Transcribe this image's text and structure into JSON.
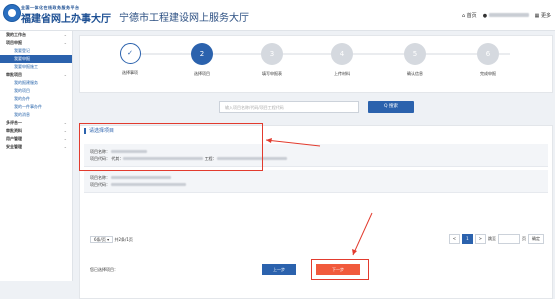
{
  "header": {
    "logo_small": "全国一体化在线政务服务平台",
    "logo_big": "福建省网上办事大厅",
    "site_title": "宁德市工程建设网上服务大厅",
    "home": "首页",
    "more": "更多"
  },
  "sidebar": {
    "items": [
      {
        "label": "我的工作台",
        "type": "group"
      },
      {
        "label": "项目申报",
        "type": "group"
      },
      {
        "label": "我要登记",
        "type": "sub"
      },
      {
        "label": "我要申报",
        "type": "sub",
        "active": true
      },
      {
        "label": "我要申报施工",
        "type": "sub"
      },
      {
        "label": "审批项目",
        "type": "group"
      },
      {
        "label": "我的报建服务",
        "type": "sub"
      },
      {
        "label": "我的项目",
        "type": "sub"
      },
      {
        "label": "我的办件",
        "type": "sub"
      },
      {
        "label": "我的一件事办件",
        "type": "sub"
      },
      {
        "label": "我的消息",
        "type": "sub"
      },
      {
        "label": "多评合一",
        "type": "group"
      },
      {
        "label": "审批资料",
        "type": "group"
      },
      {
        "label": "用户管理",
        "type": "group"
      },
      {
        "label": "安全管理",
        "type": "group"
      }
    ]
  },
  "steps": [
    {
      "label": "选择事项",
      "num": "✓",
      "state": "done"
    },
    {
      "label": "选择项目",
      "num": "2",
      "state": "current"
    },
    {
      "label": "填写申报表",
      "num": "3",
      "state": "todo"
    },
    {
      "label": "上传材料",
      "num": "4",
      "state": "todo"
    },
    {
      "label": "确认信息",
      "num": "5",
      "state": "todo"
    },
    {
      "label": "完成申报",
      "num": "6",
      "state": "todo"
    }
  ],
  "search": {
    "placeholder": "输入项目名称/代码/项目工程代码",
    "button": "Q 搜索"
  },
  "panel": {
    "title": "请选择项目",
    "projects": [
      {
        "name_label": "项目名称：",
        "code_label": "项目代码：",
        "code_prefix": "代其：",
        "code_suffix": "工程："
      },
      {
        "name_label": "项目名称：",
        "code_label": "项目代码：",
        "code_prefix": "",
        "code_suffix": ""
      }
    ],
    "page_size": "6条/页 ▾",
    "total": "共2条/1页",
    "prev": "<",
    "page": "1",
    "next": ">",
    "goto": "跳至",
    "page_unit": "页",
    "confirm": "确定",
    "selected_label": "您已选择项目："
  },
  "buttons": {
    "prev": "上一步",
    "next": "下一步"
  },
  "colors": {
    "primary": "#2b62ad",
    "next_button": "#f15a3c",
    "annotation_red": "#e23b2e"
  }
}
